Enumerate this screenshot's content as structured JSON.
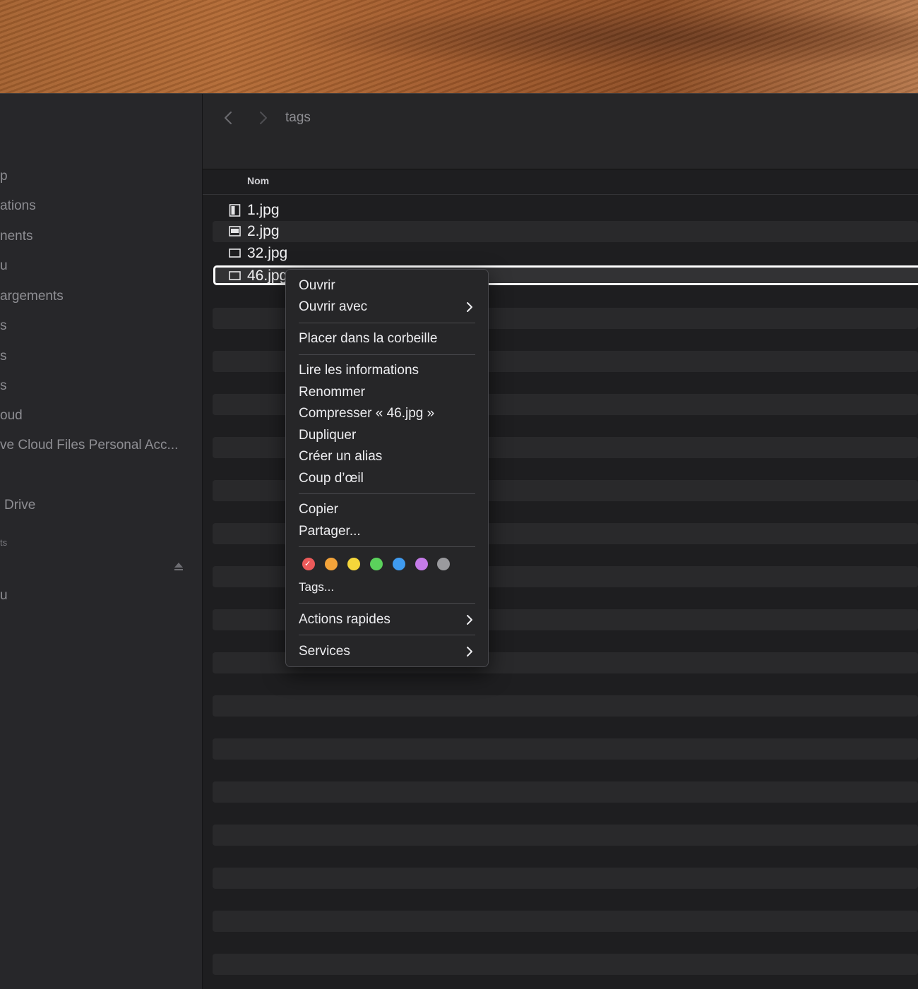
{
  "window": {
    "location_title": "tags"
  },
  "sidebar": {
    "items": [
      {
        "label": "p"
      },
      {
        "label": "ations"
      },
      {
        "label": "nents"
      },
      {
        "label": "u"
      },
      {
        "label": "argements"
      },
      {
        "label": "s"
      },
      {
        "label": "s"
      },
      {
        "label": "s"
      },
      {
        "label": "oud"
      },
      {
        "label": "ve Cloud Files Personal Acc..."
      },
      {
        "label": "Drive"
      },
      {
        "label": "ts"
      },
      {
        "label": "u"
      }
    ]
  },
  "list": {
    "column_name": "Nom",
    "files": [
      {
        "name": "1.jpg",
        "icon": "portrait-image-file-icon"
      },
      {
        "name": "2.jpg",
        "icon": "landscape-image-file-icon"
      },
      {
        "name": "32.jpg",
        "icon": "image-file-icon"
      },
      {
        "name": "46.jpg",
        "icon": "image-file-icon",
        "selected": true
      }
    ]
  },
  "context_menu": {
    "open": "Ouvrir",
    "open_with": "Ouvrir avec",
    "trash": "Placer dans la corbeille",
    "get_info": "Lire les informations",
    "rename": "Renommer",
    "compress": "Compresser « 46.jpg »",
    "duplicate": "Dupliquer",
    "make_alias": "Créer un alias",
    "quick_look": "Coup d’œil",
    "copy": "Copier",
    "share": "Partager...",
    "tags": "Tags...",
    "quick_actions": "Actions rapides",
    "services": "Services",
    "tag_colors": [
      {
        "name": "red",
        "color": "#ec5a5a",
        "checked": true
      },
      {
        "name": "orange",
        "color": "#f3a33a"
      },
      {
        "name": "yellow",
        "color": "#f5d63b"
      },
      {
        "name": "green",
        "color": "#5bd25c"
      },
      {
        "name": "blue",
        "color": "#3f9bf0"
      },
      {
        "name": "purple",
        "color": "#c47be8"
      },
      {
        "name": "gray",
        "color": "#9a9a9e"
      }
    ]
  }
}
